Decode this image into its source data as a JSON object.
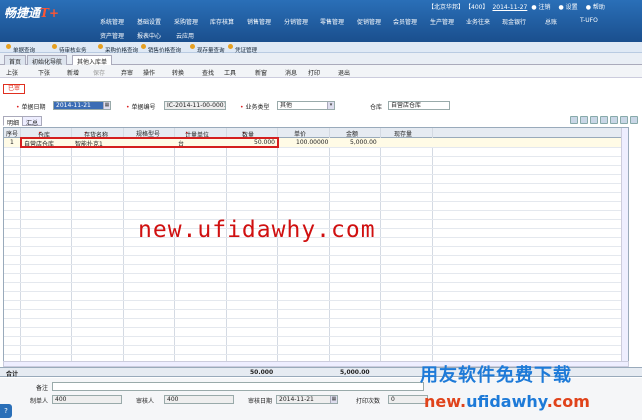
{
  "app": {
    "logo_text": "畅捷通",
    "logo_suffix": "T+"
  },
  "status": {
    "company": "【北京华邦】",
    "account": "【400】",
    "date": "2014-11-27",
    "logout": "注销",
    "settings": "设置",
    "help": "帮助"
  },
  "main_nav": [
    "系统管理",
    "基础设置",
    "采购管理",
    "库存核算",
    "销售管理",
    "分销管理",
    "零售管理",
    "促销管理",
    "会员管理",
    "生产管理",
    "业务往来",
    "现金银行",
    "总账",
    "T-UFO"
  ],
  "sub_nav": [
    "资产管理",
    "报表中心",
    "云应用"
  ],
  "favorites": [
    "单据查询",
    "待审核业务",
    "采购价格查询",
    "销售价格查询",
    "现存量查询",
    "凭证管理"
  ],
  "tabs": [
    "首页",
    "初始化导航",
    "其他入库单"
  ],
  "toolbar": [
    {
      "label": "上张",
      "disabled": false
    },
    {
      "label": "下张",
      "disabled": false
    },
    {
      "label": "新增",
      "disabled": false
    },
    {
      "label": "保存",
      "disabled": true
    },
    {
      "label": "弃审",
      "disabled": false
    },
    {
      "label": "操作",
      "disabled": false
    },
    {
      "label": "转换",
      "disabled": false
    },
    {
      "label": "查找",
      "disabled": false
    },
    {
      "label": "工具",
      "disabled": false
    },
    {
      "label": "新窗",
      "disabled": false
    },
    {
      "label": "消息",
      "disabled": false
    },
    {
      "label": "打印",
      "disabled": false
    },
    {
      "label": "退出",
      "disabled": false
    }
  ],
  "audit_badge": "已审",
  "header_fields": {
    "doc_date_label": "单据日期",
    "doc_date_value": "2014-11-21",
    "doc_no_label": "单据编号",
    "doc_no_value": "IC-2014-11-00-0001",
    "biz_type_label": "业务类型",
    "biz_type_value": "其他",
    "warehouse_label": "仓库",
    "warehouse_value": "自营店仓库"
  },
  "sub_tabs": [
    "明细",
    "汇总"
  ],
  "grid": {
    "columns": [
      "序号",
      "仓库",
      "存货名称",
      "规格型号",
      "计量单位",
      "数量",
      "单价",
      "金额",
      "现存量"
    ],
    "rows": [
      {
        "no": "1",
        "warehouse": "自营店仓库",
        "item": "智能扑克1",
        "spec": "",
        "unit": "台",
        "qty": "50.000",
        "price": "100.00000",
        "amount": "5,000.00",
        "stock": ""
      }
    ]
  },
  "totals": {
    "label": "合计",
    "qty": "50.000",
    "amount": "5,000.00"
  },
  "footer": {
    "remark_label": "备注",
    "maker_label": "制单人",
    "maker_value": "400",
    "auditor_label": "审核人",
    "auditor_value": "400",
    "audit_date_label": "审核日期",
    "audit_date_value": "2014-11-21",
    "print_count_label": "打印次数",
    "print_count_value": "0"
  },
  "watermarks": {
    "center": "new.ufidawhy.com",
    "corner_cn": "用友软件免费下载",
    "corner_url_a": "new.",
    "corner_url_b": "ufidawhy",
    "corner_url_c": ".com"
  },
  "colors": {
    "topbar": "#2a6fb8",
    "highlight": "#d41f1f",
    "badge": "#e03020"
  }
}
